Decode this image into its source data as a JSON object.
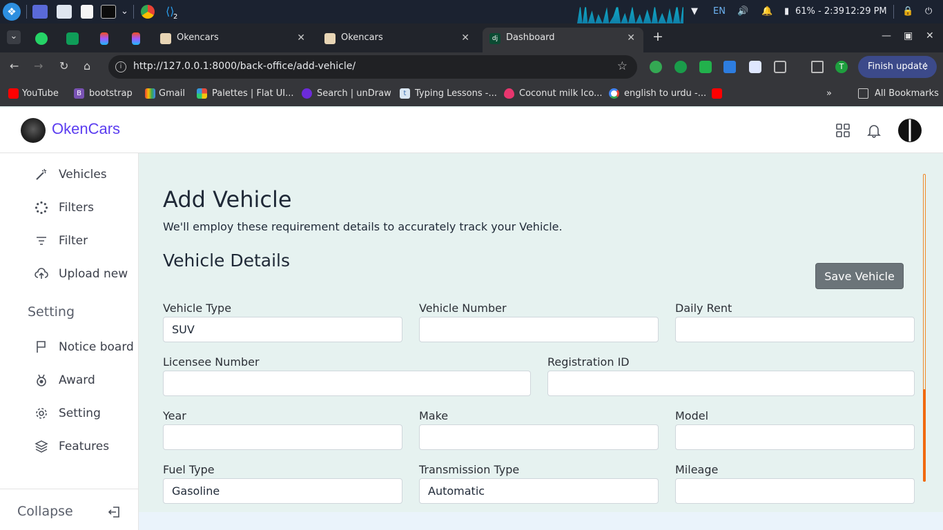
{
  "os": {
    "workspace_badge": "2",
    "battery": "61% - 2:39",
    "time": "12:29 PM",
    "language": "EN"
  },
  "browser": {
    "tabs": [
      {
        "label": "Okencars",
        "active": false
      },
      {
        "label": "Okencars",
        "active": false
      },
      {
        "label": "Dashboard",
        "active": true
      }
    ],
    "url": "http://127.0.0.1:8000/back-office/add-vehicle/",
    "finish_update": "Finish update",
    "profile_initial": "T",
    "bookmarks": [
      "YouTube",
      "bootstrap",
      "Gmail",
      "Palettes | Flat UI...",
      "Search | unDraw",
      "Typing Lessons -...",
      "Coconut milk Ico...",
      "english to urdu -..."
    ],
    "bookmark_badges": {
      "bootstrap": "B",
      "typing": "t"
    },
    "all_bookmarks": "All Bookmarks",
    "overflow": "»"
  },
  "app": {
    "brand": "OkenCars",
    "colors": {
      "brand": "#5b3df0",
      "scroll": "#f06a10",
      "button": "#6b7479"
    }
  },
  "sidebar": {
    "items": [
      {
        "label": "Vehicles",
        "icon": "magic-wand-icon"
      },
      {
        "label": "Filters",
        "icon": "spinner-icon"
      },
      {
        "label": "Filter",
        "icon": "filter-lines-icon"
      },
      {
        "label": "Upload new",
        "icon": "cloud-upload-icon"
      }
    ],
    "section": "Setting",
    "setting_items": [
      {
        "label": "Notice board",
        "icon": "flag-icon"
      },
      {
        "label": "Award",
        "icon": "award-icon"
      },
      {
        "label": "Setting",
        "icon": "gear-icon"
      },
      {
        "label": "Features",
        "icon": "layers-icon"
      }
    ],
    "collapse": "Collapse"
  },
  "main": {
    "title": "Add Vehicle",
    "subtitle": "We'll employ these requirement details to accurately track your Vehicle.",
    "section": "Vehicle Details",
    "save_button": "Save Vehicle",
    "fields": {
      "vehicle_type": {
        "label": "Vehicle Type",
        "value": "SUV"
      },
      "vehicle_number": {
        "label": "Vehicle Number",
        "value": ""
      },
      "daily_rent": {
        "label": "Daily Rent",
        "value": ""
      },
      "licensee_number": {
        "label": "Licensee Number",
        "value": ""
      },
      "registration_id": {
        "label": "Registration ID",
        "value": ""
      },
      "year": {
        "label": "Year",
        "value": ""
      },
      "make": {
        "label": "Make",
        "value": ""
      },
      "model": {
        "label": "Model",
        "value": ""
      },
      "fuel_type": {
        "label": "Fuel Type",
        "value": "Gasoline"
      },
      "transmission_type": {
        "label": "Transmission Type",
        "value": "Automatic"
      },
      "mileage": {
        "label": "Mileage",
        "value": ""
      }
    }
  }
}
